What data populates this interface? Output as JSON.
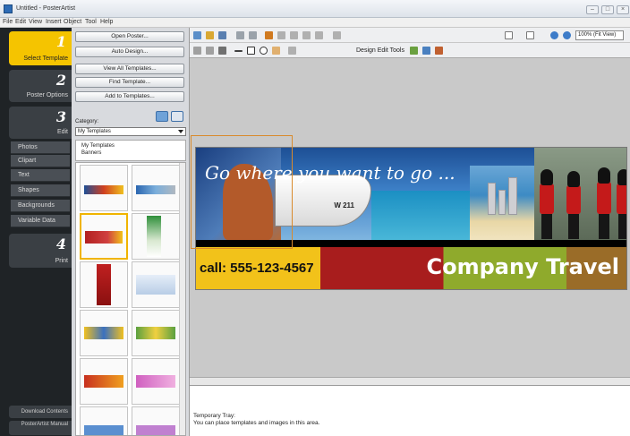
{
  "window": {
    "title": "Untitled - PosterArtist"
  },
  "menu": [
    "File",
    "Edit",
    "View",
    "Insert",
    "Object",
    "Tool",
    "Help"
  ],
  "sidebar": {
    "steps": [
      {
        "num": "1",
        "label": "Select Template"
      },
      {
        "num": "2",
        "label": "Poster Options"
      },
      {
        "num": "3",
        "label": "Edit"
      },
      {
        "num": "4",
        "label": "Print"
      }
    ],
    "edit_items": [
      "Photos",
      "Clipart",
      "Text",
      "Shapes",
      "Backgrounds",
      "Variable Data"
    ],
    "download_label": "Download Contents",
    "manual_label": "PosterArtist Manual"
  },
  "template_panel": {
    "open_poster": "Open Poster...",
    "auto_design": "Auto Design...",
    "view_all": "View All Templates...",
    "find": "Find Template...",
    "add": "Add to Templates...",
    "category_label": "Category:",
    "category_value": "My Templates",
    "tree": [
      "My Templates",
      "Banners"
    ]
  },
  "toolbar": {
    "zoom": "100% (Fit View)",
    "design_edit_tools": "Design Edit Tools"
  },
  "poster": {
    "slogan": "Go where you want to go ...",
    "phone": "call: 555-123-4567",
    "company": "Company Travel",
    "boat_number": "W 211"
  },
  "tray": {
    "title": "Temporary Tray:",
    "hint": "You can place templates and images in this area."
  },
  "colors": {
    "accent": "#f5c400",
    "sidebar": "#1f2326",
    "selection": "#d98a2c"
  }
}
